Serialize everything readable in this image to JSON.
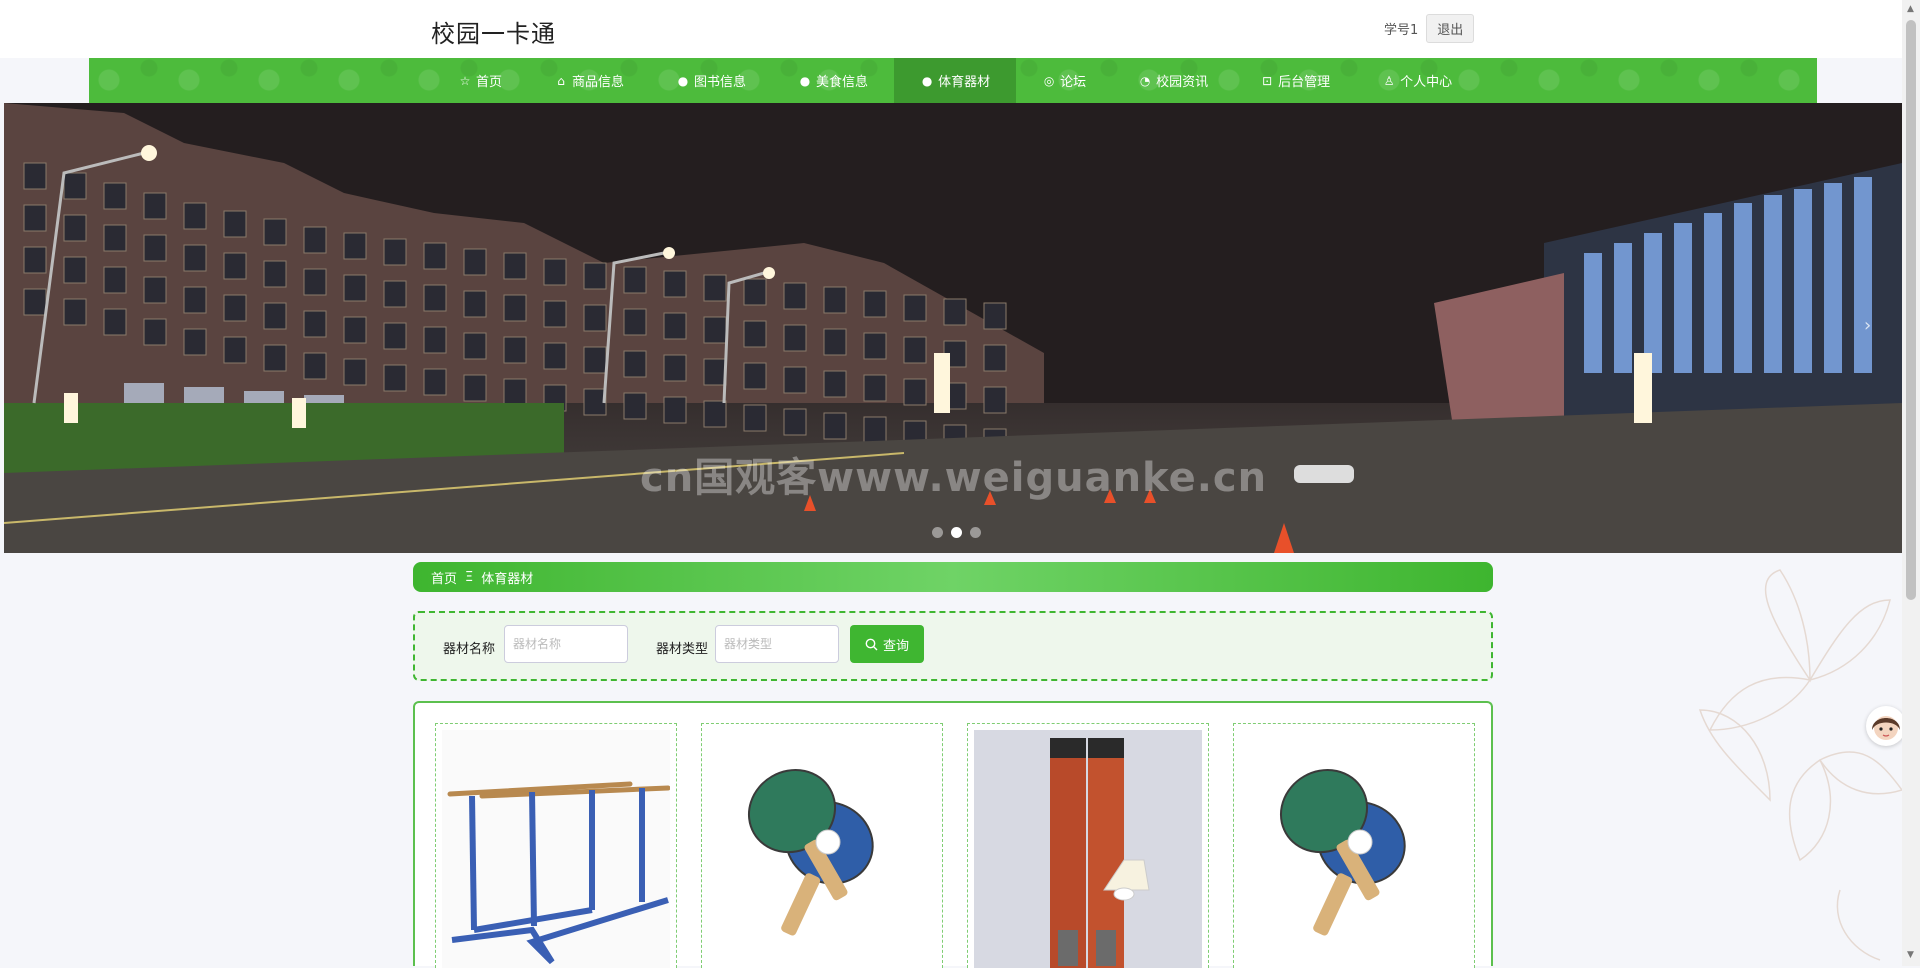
{
  "header": {
    "site_title": "校园一卡通",
    "user_name": "学号1",
    "logout_label": "退出"
  },
  "nav": {
    "items": [
      {
        "label": "首页",
        "icon": "star-icon"
      },
      {
        "label": "商品信息",
        "icon": "bag-icon"
      },
      {
        "label": "图书信息",
        "icon": "info-icon"
      },
      {
        "label": "美食信息",
        "icon": "question-icon"
      },
      {
        "label": "体育器材",
        "icon": "info-icon",
        "active": true
      },
      {
        "label": "论坛",
        "icon": "globe-icon"
      },
      {
        "label": "校园资讯",
        "icon": "compass-icon"
      },
      {
        "label": "后台管理",
        "icon": "gift-icon"
      },
      {
        "label": "个人中心",
        "icon": "user-icon"
      }
    ]
  },
  "banner": {
    "watermark": "cn国观客www.weiguanke.cn",
    "active_slide": 2,
    "slide_count": 3
  },
  "breadcrumb": {
    "home": "首页",
    "separator": "Ξ",
    "current": "体育器材"
  },
  "search": {
    "name_label": "器材名称",
    "name_placeholder": "器材名称",
    "type_label": "器材类型",
    "type_placeholder": "器材类型",
    "button_label": "查询"
  },
  "products": [
    {
      "image": "parallel-bars"
    },
    {
      "image": "ping-pong-paddles"
    },
    {
      "image": "badminton-shuttlecock-tubes"
    },
    {
      "image": "ping-pong-paddles"
    }
  ],
  "colors": {
    "brand_green": "#4dbb3c",
    "nav_active": "#3d9a2f",
    "panel_bg": "#eef7ec"
  }
}
